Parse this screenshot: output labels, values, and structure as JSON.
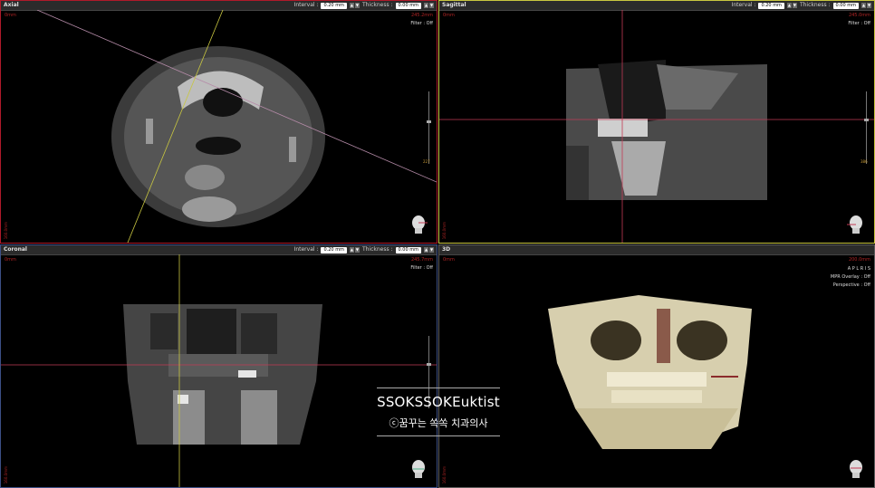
{
  "panes": {
    "axial": {
      "title": "Axial",
      "interval_label": "Interval :",
      "interval_value": "0.20 mm",
      "thickness_label": "Thickness :",
      "thickness_value": "0.00 mm",
      "corner_left": "0mm",
      "corner_right": "245.2mm",
      "filter": "Filter : Off",
      "side_label": "160.0mm",
      "slider_value": "227",
      "icon": "head-orientation-icon"
    },
    "sagittal": {
      "title": "Sagittal",
      "interval_label": "Interval :",
      "interval_value": "0.20 mm",
      "thickness_label": "Thickness :",
      "thickness_value": "0.00 mm",
      "corner_left": "0mm",
      "corner_right": "245.0mm",
      "filter": "Filter : Off",
      "side_label": "160.0mm",
      "slider_value": "386",
      "icon": "head-orientation-icon"
    },
    "coronal": {
      "title": "Coronal",
      "interval_label": "Interval :",
      "interval_value": "0.20 mm",
      "thickness_label": "Thickness :",
      "thickness_value": "0.00 mm",
      "corner_left": "0mm",
      "corner_right": "245.7mm",
      "filter": "Filter : Off",
      "side_label": "160.0mm",
      "slider_value": "",
      "icon": "head-orientation-icon"
    },
    "three_d": {
      "title": "3D",
      "corner_left": "0mm",
      "corner_right": "200.0mm",
      "orientation": "A P L R I S",
      "mpr_overlay": "MPR Overlay : Off",
      "perspective": "Perspective : Off",
      "side_label": "160.0mm",
      "icon": "head-orientation-icon"
    }
  },
  "watermark": {
    "line1": "SSOKSSOKEuktist",
    "line2": "ⓒ꿈꾸는 쏙쏙 치과의사"
  },
  "colors": {
    "axial_border": "#b01a2a",
    "sagittal_border": "#c8c640",
    "coronal_border": "#3c4f86",
    "crosshair_red": "#c23a55",
    "crosshair_yellow": "#c8c640"
  }
}
